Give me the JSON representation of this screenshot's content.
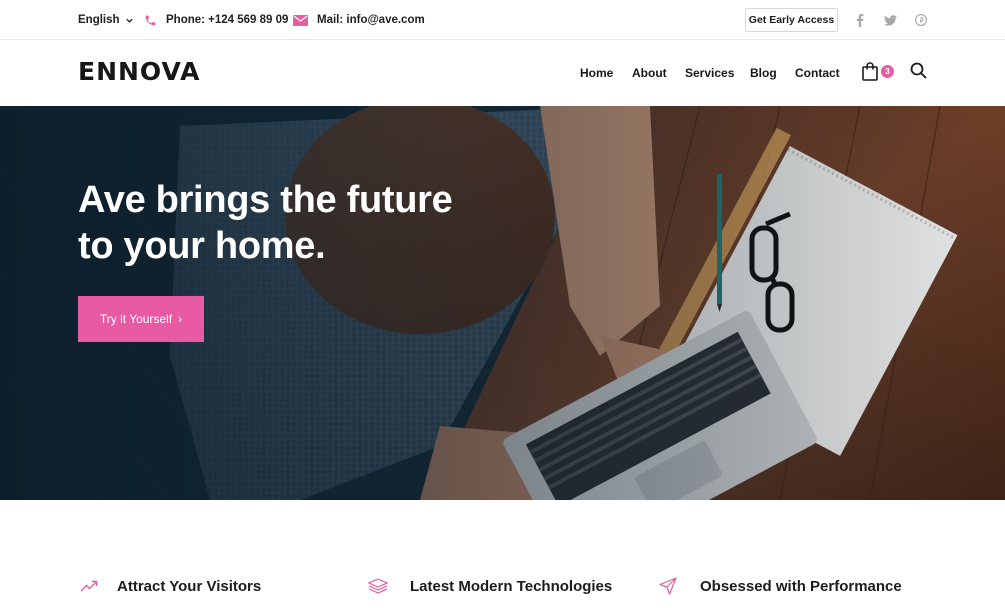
{
  "topbar": {
    "language": "English",
    "phone": "Phone: +124 569 89 09",
    "mail": "Mail: info@ave.com",
    "cta_label": "Get Early Access",
    "social": [
      "facebook-icon",
      "twitter-icon",
      "pinterest-icon"
    ]
  },
  "header": {
    "logo": "ENNOVA",
    "nav": [
      "Home",
      "About",
      "Services",
      "Blog",
      "Contact"
    ],
    "cart_count": "3"
  },
  "hero": {
    "title_line1": "Ave brings the future",
    "title_line2": "to your home.",
    "button_label": "Try it Yourself",
    "button_arrow": "›"
  },
  "features": [
    {
      "icon": "trending-up-icon",
      "title": "Attract Your Visitors"
    },
    {
      "icon": "layers-icon",
      "title": "Latest Modern Technologies"
    },
    {
      "icon": "send-icon",
      "title": "Obsessed with Performance"
    }
  ],
  "colors": {
    "accent": "#e85aa3",
    "text": "#1c1c1c",
    "hero_dark": "#0f2433"
  }
}
